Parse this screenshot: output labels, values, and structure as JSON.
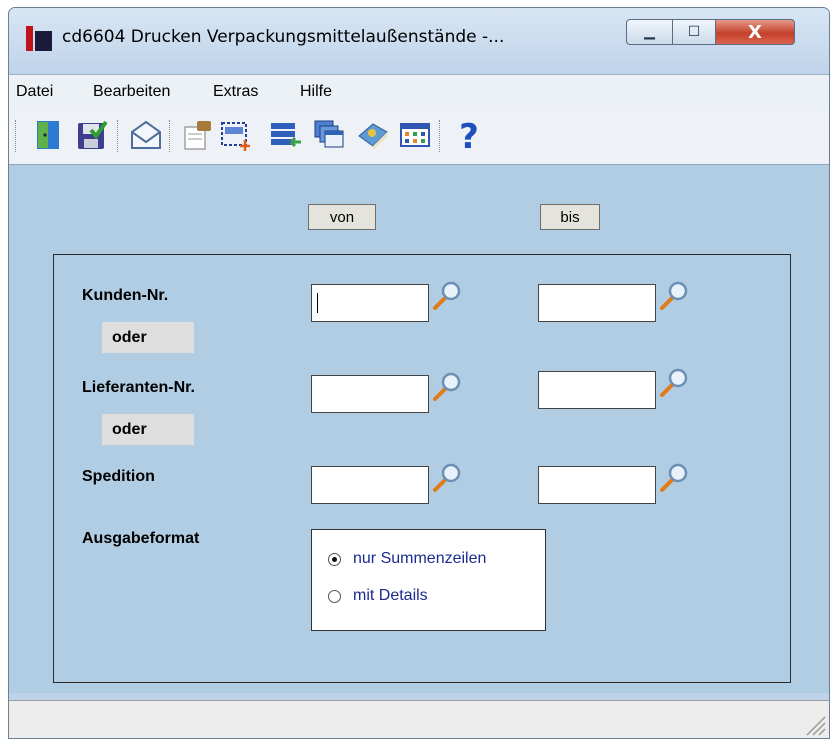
{
  "window": {
    "title": "cd6604 Drucken Verpackungsmittelaußenstände -...",
    "min_label": "▁",
    "max_label": "☐",
    "close_label": "X"
  },
  "menu": [
    {
      "label": "Datei"
    },
    {
      "label": "Bearbeiten"
    },
    {
      "label": "Extras"
    },
    {
      "label": "Hilfe"
    }
  ],
  "toolbar": {
    "icons": [
      "exit-door-icon",
      "save-icon",
      "mail-icon",
      "edit-icon",
      "new-selection-icon",
      "import-list-icon",
      "windows-icon",
      "book-icon",
      "calendar-grid-icon",
      "help-icon"
    ]
  },
  "headers": {
    "from": "von",
    "to": "bis"
  },
  "form": {
    "customer_label": "Kunden-Nr.",
    "or_label": "oder",
    "supplier_label": "Lieferanten-Nr.",
    "carrier_label": "Spedition",
    "output_label": "Ausgabeformat",
    "fields": {
      "customer_from": "",
      "customer_to": "",
      "supplier_from": "",
      "supplier_to": "",
      "carrier_from": "",
      "carrier_to": ""
    },
    "output_options": [
      {
        "label": "nur Summenzeilen",
        "selected": true
      },
      {
        "label": "mit Details",
        "selected": false
      }
    ]
  },
  "colors": {
    "content_bg": "#b0cde3",
    "radio_text": "#1a2b8f",
    "close_button": "#c3412a"
  }
}
